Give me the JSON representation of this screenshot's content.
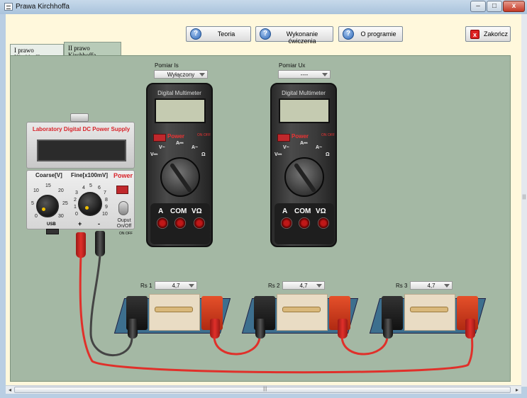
{
  "window": {
    "title": "Prawa Kirchhoffa",
    "minimize": "–",
    "maximize": "□",
    "close": "x"
  },
  "toolbar": {
    "teoria": "Teoria",
    "wykonanie": "Wykonanie ćwiczenia",
    "oprogramie": "O programie",
    "zakoncz": "Zakończ",
    "help_icon": "?",
    "close_icon": "x"
  },
  "tabs": [
    {
      "label": "I prawo Kirchhoffa",
      "active": false
    },
    {
      "label": "II prawo Kirchhoffa",
      "active": true
    }
  ],
  "power_supply": {
    "title": "Laboratory Digital DC Power Supply",
    "coarse_label": "Coarse[V]",
    "fine_label": "Fine[x100mV]",
    "power_label": "Power",
    "coarse_ticks": [
      "15",
      "20",
      "10",
      "25",
      "5",
      "0",
      "30"
    ],
    "fine_ticks": [
      "4",
      "5",
      "6",
      "3",
      "7",
      "2",
      "8",
      "1",
      "9",
      "0",
      "10"
    ],
    "output_label": "Ouput On/Off",
    "usb_label": "USB",
    "plus": "+",
    "minus": "-",
    "on_off_small": "ON OFF"
  },
  "meters": [
    {
      "label": "Pomiar Is",
      "selection": "Wyłączony",
      "title": "Digital Multimeter",
      "power": "Power",
      "onoff": "ON OFF",
      "ranges": [
        "V~",
        "A⎓",
        "A~",
        "V⎓",
        "Ω"
      ],
      "jacks": [
        "A",
        "COM",
        "VΩ"
      ]
    },
    {
      "label": "Pomiar Ux",
      "selection": "----",
      "title": "Digital Multimeter",
      "power": "Power",
      "onoff": "ON OFF",
      "ranges": [
        "V~",
        "A⎓",
        "A~",
        "V⎓",
        "Ω"
      ],
      "jacks": [
        "A",
        "COM",
        "VΩ"
      ]
    }
  ],
  "resistors": [
    {
      "label": "Rs 1",
      "value": "4,7"
    },
    {
      "label": "Rs 2",
      "value": "4,7"
    },
    {
      "label": "Rs 3",
      "value": "4,7"
    }
  ],
  "scrollbar": {
    "left": "◂",
    "right": "▸",
    "grip": "|||"
  },
  "colors": {
    "panel": "#a4b8a4",
    "client": "#fff8dc",
    "wire_red": "#e0302a",
    "wire_black": "#444444"
  }
}
